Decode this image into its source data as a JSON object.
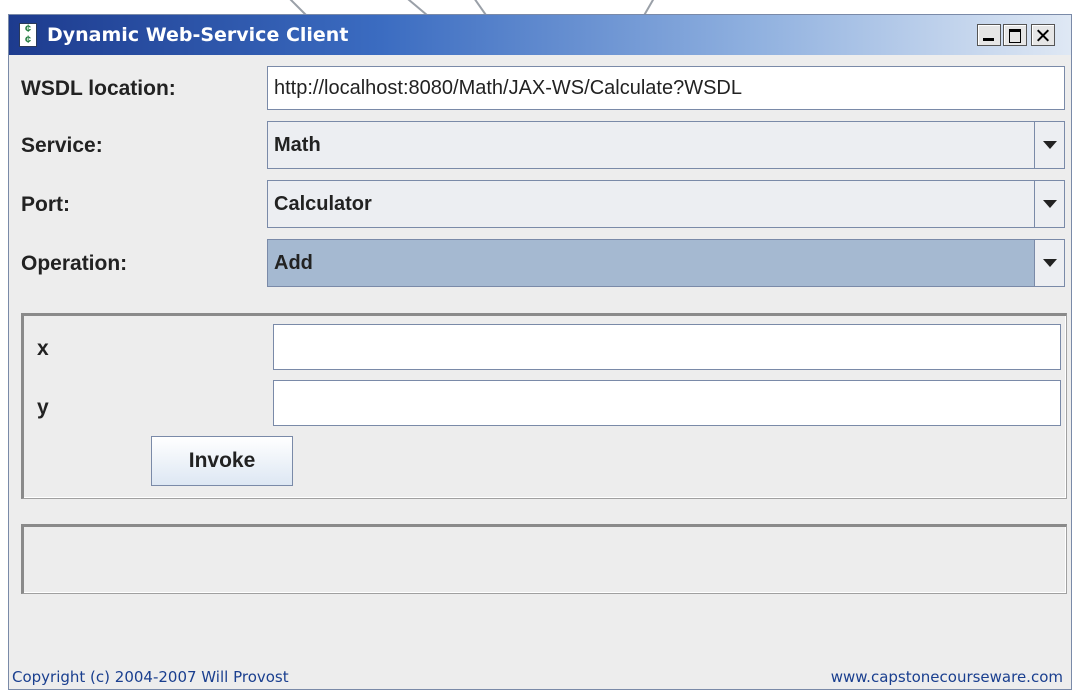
{
  "window": {
    "title": "Dynamic Web-Service Client",
    "icon_glyph": "¢\n¢",
    "controls": {
      "minimize": "minimize",
      "maximize": "maximize",
      "close": "close"
    }
  },
  "form": {
    "wsdl_label": "WSDL location:",
    "wsdl_value": "http://localhost:8080/Math/JAX-WS/Calculate?WSDL",
    "service_label": "Service:",
    "service_value": "Math",
    "port_label": "Port:",
    "port_value": "Calculator",
    "operation_label": "Operation:",
    "operation_value": "Add"
  },
  "params": {
    "x_label": "x",
    "x_value": "",
    "y_label": "y",
    "y_value": "",
    "invoke_label": "Invoke"
  },
  "result": {
    "value": ""
  },
  "footer": {
    "copyright": "Copyright (c) 2004-2007 Will Provost",
    "website": "www.capstonecourseware.com"
  },
  "colors": {
    "title_gradient_start": "#1d3b8e",
    "selected_combo": "#a5b9d1",
    "footer_link": "#1a3f8f"
  }
}
